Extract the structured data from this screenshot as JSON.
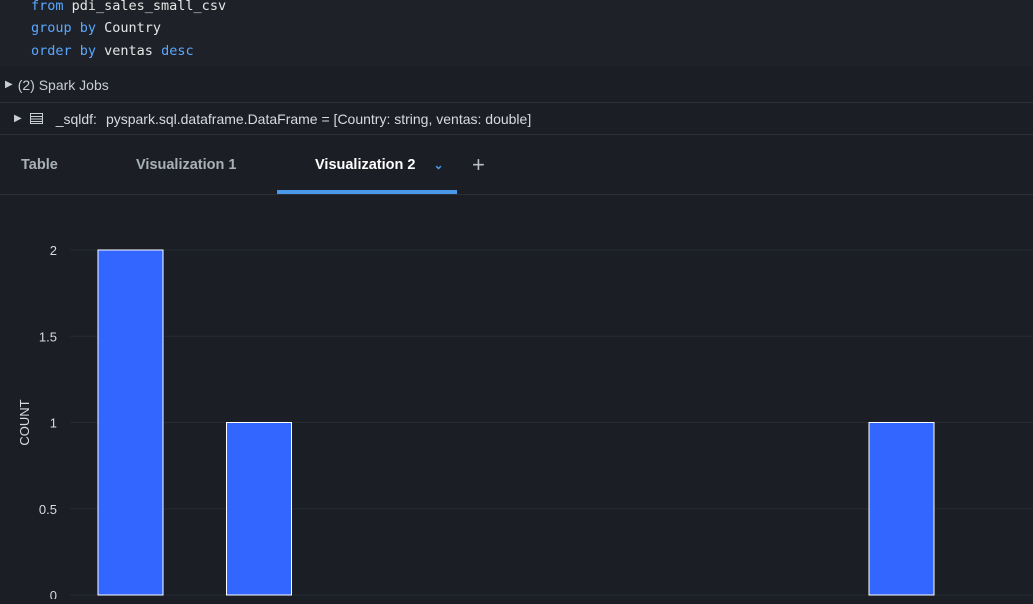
{
  "code": {
    "lines": [
      {
        "kw": "from",
        "rest": " pdi_sales_small_csv"
      },
      {
        "kw": "group by",
        "rest": " Country"
      },
      {
        "kw": "order by",
        "rest": " ventas ",
        "kw2": "desc"
      }
    ]
  },
  "spark_jobs": {
    "label": "(2) Spark Jobs"
  },
  "dataframe": {
    "name": "_sqldf:",
    "schema": "pyspark.sql.dataframe.DataFrame = [Country: string, ventas: double]"
  },
  "tabs": {
    "items": [
      "Table",
      "Visualization 1",
      "Visualization 2"
    ],
    "active": "Visualization 2",
    "add_label": "+"
  },
  "colors": {
    "bar": "#3366ff",
    "background": "#1b1f25",
    "accent": "#4a98e8"
  },
  "chart_data": {
    "type": "bar",
    "title": "",
    "xlabel": "",
    "ylabel": "COUNT",
    "ylim": [
      0,
      2
    ],
    "yticks": [
      "0",
      "0.5",
      "1",
      "1.5",
      "2"
    ],
    "categories": [
      "",
      "",
      "",
      "",
      "",
      "",
      ""
    ],
    "values": [
      2,
      1,
      0,
      0,
      0,
      0,
      1
    ]
  }
}
